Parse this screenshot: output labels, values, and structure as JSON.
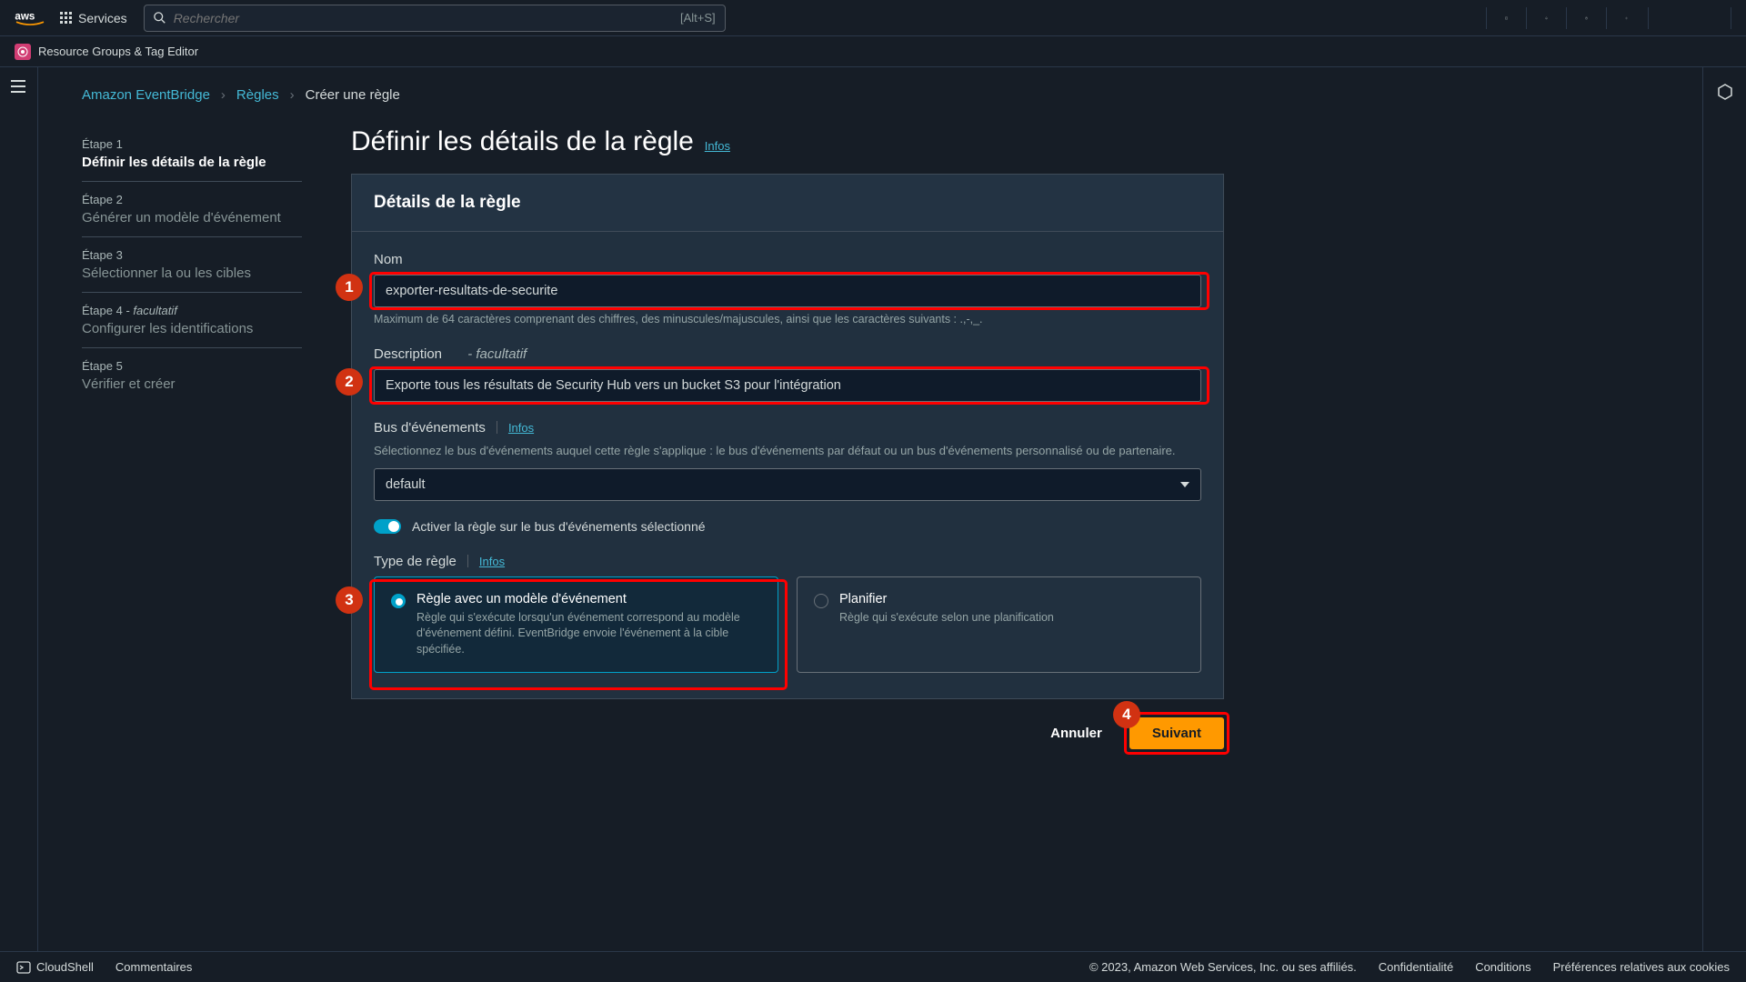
{
  "top_nav": {
    "services_label": "Services",
    "search_placeholder": "Rechercher",
    "search_shortcut": "[Alt+S]"
  },
  "sec_nav": {
    "label": "Resource Groups & Tag Editor"
  },
  "breadcrumbs": {
    "service": "Amazon EventBridge",
    "rules": "Règles",
    "current": "Créer une règle"
  },
  "steps": [
    {
      "label": "Étape 1",
      "title": "Définir les détails de la règle",
      "active": true
    },
    {
      "label": "Étape 2",
      "title": "Générer un modèle d'événement"
    },
    {
      "label": "Étape 3",
      "title": "Sélectionner la ou les cibles"
    },
    {
      "label": "Étape 4",
      "optional": "facultatif",
      "title": "Configurer les identifications"
    },
    {
      "label": "Étape 5",
      "title": "Vérifier et créer"
    }
  ],
  "page": {
    "title": "Définir les détails de la règle",
    "info": "Infos"
  },
  "card": {
    "header": "Détails de la règle"
  },
  "name": {
    "label": "Nom",
    "value": "exporter-resultats-de-securite",
    "help": "Maximum de 64 caractères comprenant des chiffres, des minuscules/majuscules, ainsi que les caractères suivants : .,-,_."
  },
  "desc": {
    "label": "Description",
    "optional": "- facultatif",
    "value": "Exporte tous les résultats de Security Hub vers un bucket S3 pour l'intégration"
  },
  "bus": {
    "label": "Bus d'événements",
    "info": "Infos",
    "desc": "Sélectionnez le bus d'événements auquel cette règle s'applique : le bus d'événements par défaut ou un bus d'événements personnalisé ou de partenaire.",
    "value": "default"
  },
  "toggle": {
    "label": "Activer la règle sur le bus d'événements sélectionné"
  },
  "rule_type": {
    "label": "Type de règle",
    "info": "Infos",
    "pattern": {
      "title": "Règle avec un modèle d'événement",
      "desc": "Règle qui s'exécute lorsqu'un événement correspond au modèle d'événement défini. EventBridge envoie l'événement à la cible spécifiée."
    },
    "schedule": {
      "title": "Planifier",
      "desc": "Règle qui s'exécute selon une planification"
    }
  },
  "buttons": {
    "cancel": "Annuler",
    "next": "Suivant"
  },
  "footer": {
    "cloudshell": "CloudShell",
    "comments": "Commentaires",
    "copyright": "© 2023, Amazon Web Services, Inc. ou ses affiliés.",
    "privacy": "Confidentialité",
    "terms": "Conditions",
    "cookies": "Préférences relatives aux cookies"
  },
  "markers": {
    "m1": "1",
    "m2": "2",
    "m3": "3",
    "m4": "4"
  }
}
